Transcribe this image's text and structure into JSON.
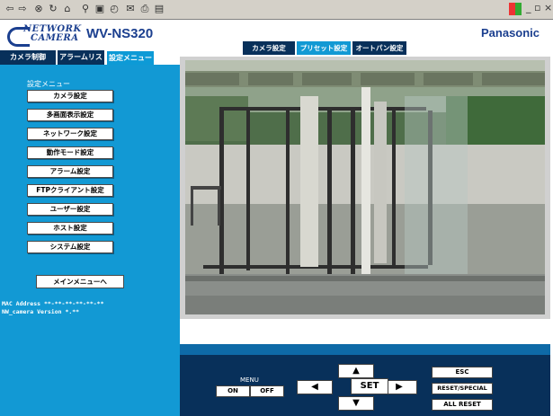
{
  "toolbar": {
    "icons": [
      "back-icon",
      "forward-icon",
      "stop-icon",
      "refresh-icon",
      "home-icon",
      "search-icon",
      "favorites-icon",
      "history-icon",
      "mail-icon",
      "print-icon",
      "edit-icon"
    ],
    "window_controls": "_ ▫ ×"
  },
  "header": {
    "logo_top": "NETWORK",
    "logo_bottom": "CAMERA",
    "model": "WV-NS320",
    "brand": "Panasonic"
  },
  "left_tabs": [
    {
      "label": "カメラ制御"
    },
    {
      "label": "アラームリスト"
    },
    {
      "label": "設定メニュー"
    }
  ],
  "sidebar": {
    "title": "設定メニュー",
    "items": [
      {
        "label": "カメラ設定"
      },
      {
        "label": "多画面表示設定"
      },
      {
        "label": "ネットワーク設定"
      },
      {
        "label": "動作モード設定"
      },
      {
        "label": "アラーム設定"
      },
      {
        "label": "FTPクライアント設定"
      },
      {
        "label": "ユーザー設定"
      },
      {
        "label": "ホスト設定"
      },
      {
        "label": "システム設定"
      }
    ],
    "main_menu": "メインメニューへ",
    "mac_line": "MAC Address **-**-**-**-**-**",
    "version_line": "NW_camera Version *.**"
  },
  "right_tabs": [
    {
      "label": "カメラ設定"
    },
    {
      "label": "プリセット設定"
    },
    {
      "label": "オートパン設定"
    }
  ],
  "controls": {
    "menu_label": "MENU",
    "on": "ON",
    "off": "OFF",
    "set": "SET",
    "esc": "ESC",
    "reset_special": "RESET/SPECIAL",
    "all_reset": "ALL RESET",
    "up": "▲",
    "down": "▼",
    "left": "◀",
    "right": "▶"
  },
  "colors": {
    "sidebar": "#1299d4",
    "dark_navy": "#08305a",
    "brand_blue": "#1b3f8f"
  }
}
